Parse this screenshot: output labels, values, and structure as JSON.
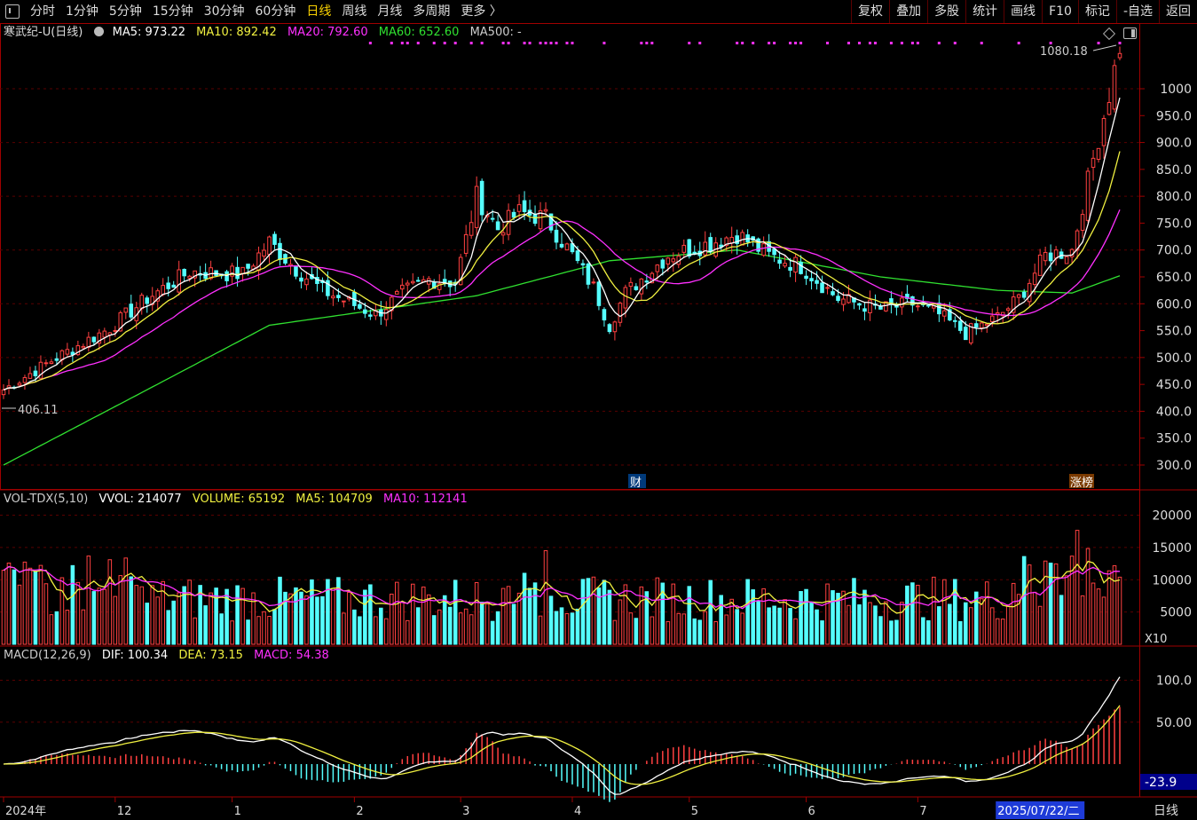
{
  "toolbar": {
    "periods": [
      "分时",
      "1分钟",
      "5分钟",
      "15分钟",
      "30分钟",
      "60分钟",
      "日线",
      "周线",
      "月线",
      "多周期",
      "更多 〉"
    ],
    "active_period": "日线",
    "actions": [
      "复权",
      "叠加",
      "多股",
      "统计",
      "画线",
      "F10",
      "标记",
      "-自选",
      "返回"
    ]
  },
  "main_panel": {
    "title": "寒武纪-U(日线)",
    "ma5": "MA5: 973.22",
    "ma10": "MA10: 892.42",
    "ma20": "MA20: 792.60",
    "ma60": "MA60: 652.60",
    "ma500": "MA500: -",
    "high_label": "1080.18",
    "low_label": "406.11",
    "axis_labels": [
      "1000",
      "950.0",
      "900.0",
      "850.0",
      "800.0",
      "750.0",
      "700.0",
      "650.0",
      "600.0",
      "550.0",
      "500.0",
      "450.0",
      "400.0",
      "350.0",
      "300.0"
    ],
    "marker_cai": "财",
    "marker_zhangbang": "涨榜"
  },
  "volume_panel": {
    "title": "VOL-TDX(5,10)",
    "vvol": "VVOL: 214077",
    "volume": "VOLUME: 65192",
    "ma5": "MA5: 104709",
    "ma10": "MA10: 112141",
    "axis_labels": [
      "20000",
      "15000",
      "10000",
      "5000"
    ],
    "unit": "X10"
  },
  "macd_panel": {
    "title": "MACD(12,26,9)",
    "dif": "DIF: 100.34",
    "dea": "DEA: 73.15",
    "macd": "MACD: 54.38",
    "axis_labels": [
      "100.0",
      "50.00"
    ],
    "current": "-23.9"
  },
  "date_axis": {
    "labels": [
      "2024年",
      "12",
      "1",
      "2",
      "3",
      "4",
      "5",
      "6",
      "7"
    ],
    "cursor_date": "2025/07/22/二",
    "period": "日线"
  },
  "colors": {
    "up": "#ff4040",
    "down": "#5ff",
    "ma5": "#ffffff",
    "ma10": "#f0f040",
    "ma20": "#ff30ff",
    "ma60": "#30e030",
    "border": "#a00000"
  },
  "chart_data": {
    "type": "candlestick",
    "anchors_date_close": [
      [
        "2024-11-01",
        440
      ],
      [
        "2024-11-15",
        500
      ],
      [
        "2024-11-29",
        555
      ],
      [
        "2024-12-10",
        610
      ],
      [
        "2024-12-20",
        660
      ],
      [
        "2025-01-03",
        655
      ],
      [
        "2025-01-10",
        715
      ],
      [
        "2025-01-17",
        665
      ],
      [
        "2025-01-24",
        625
      ],
      [
        "2025-02-07",
        580
      ],
      [
        "2025-02-14",
        620
      ],
      [
        "2025-02-21",
        645
      ],
      [
        "2025-02-28",
        640
      ],
      [
        "2025-03-06",
        800
      ],
      [
        "2025-03-12",
        740
      ],
      [
        "2025-03-18",
        770
      ],
      [
        "2025-03-25",
        760
      ],
      [
        "2025-04-01",
        690
      ],
      [
        "2025-04-07",
        630
      ],
      [
        "2025-04-10",
        560
      ],
      [
        "2025-04-15",
        620
      ],
      [
        "2025-04-25",
        690
      ],
      [
        "2025-05-06",
        710
      ],
      [
        "2025-05-14",
        730
      ],
      [
        "2025-05-22",
        690
      ],
      [
        "2025-05-30",
        670
      ],
      [
        "2025-06-10",
        610
      ],
      [
        "2025-06-20",
        590
      ],
      [
        "2025-06-30",
        600
      ],
      [
        "2025-07-07",
        580
      ],
      [
        "2025-07-14",
        545
      ],
      [
        "2025-07-22",
        575
      ],
      [
        "2025-07-28",
        610
      ],
      [
        "2025-08-04",
        690
      ],
      [
        "2025-08-11",
        700
      ],
      [
        "2025-08-15",
        870
      ],
      [
        "2025-08-20",
        990
      ],
      [
        "2025-08-22",
        1080
      ]
    ],
    "ma60_anchors": [
      [
        "2024-11-01",
        300
      ],
      [
        "2024-12-10",
        440
      ],
      [
        "2025-01-10",
        560
      ],
      [
        "2025-03-06",
        615
      ],
      [
        "2025-04-10",
        680
      ],
      [
        "2025-05-14",
        700
      ],
      [
        "2025-06-20",
        650
      ],
      [
        "2025-07-22",
        625
      ],
      [
        "2025-08-11",
        620
      ],
      [
        "2025-08-22",
        652
      ]
    ],
    "volume_note": "daily volume in lots x10, range 0-22000",
    "macd_note": "DIF/DEA range -30 to 100"
  }
}
